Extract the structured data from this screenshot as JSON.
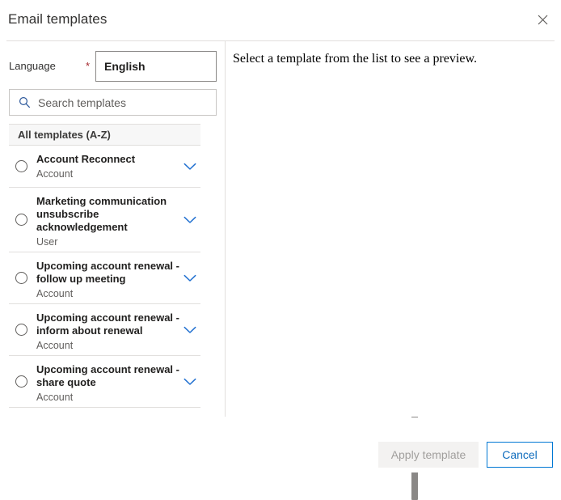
{
  "dialog": {
    "title": "Email templates",
    "close_icon": "close-icon"
  },
  "language": {
    "label": "Language",
    "required_marker": "*",
    "value": "English"
  },
  "search": {
    "icon": "search-icon",
    "placeholder": "Search templates",
    "value": ""
  },
  "list": {
    "group_header": "All templates (A-Z)",
    "chevron_icon": "chevron-down-icon",
    "items": [
      {
        "title": "Account Reconnect",
        "subtitle": "Account",
        "selected": false
      },
      {
        "title": "Marketing communication unsubscribe acknowledgement",
        "subtitle": "User",
        "selected": false
      },
      {
        "title": "Upcoming account renewal - follow up meeting",
        "subtitle": "Account",
        "selected": false
      },
      {
        "title": "Upcoming account renewal - inform about renewal",
        "subtitle": "Account",
        "selected": false
      },
      {
        "title": "Upcoming account renewal - share quote",
        "subtitle": "Account",
        "selected": false
      }
    ]
  },
  "preview": {
    "message": "Select a template from the list to see a preview."
  },
  "footer": {
    "apply_label": "Apply template",
    "apply_disabled": true,
    "cancel_label": "Cancel"
  },
  "colors": {
    "accent": "#0078d4",
    "link": "#0f6cbd",
    "required": "#a4262c",
    "border": "#e1dfdd",
    "text": "#323130",
    "subtext": "#605e5c",
    "disabled_bg": "#f3f2f1",
    "disabled_text": "#a19f9d",
    "group_header_bg": "#f7f7f7",
    "scrollbar": "#8a8886"
  }
}
